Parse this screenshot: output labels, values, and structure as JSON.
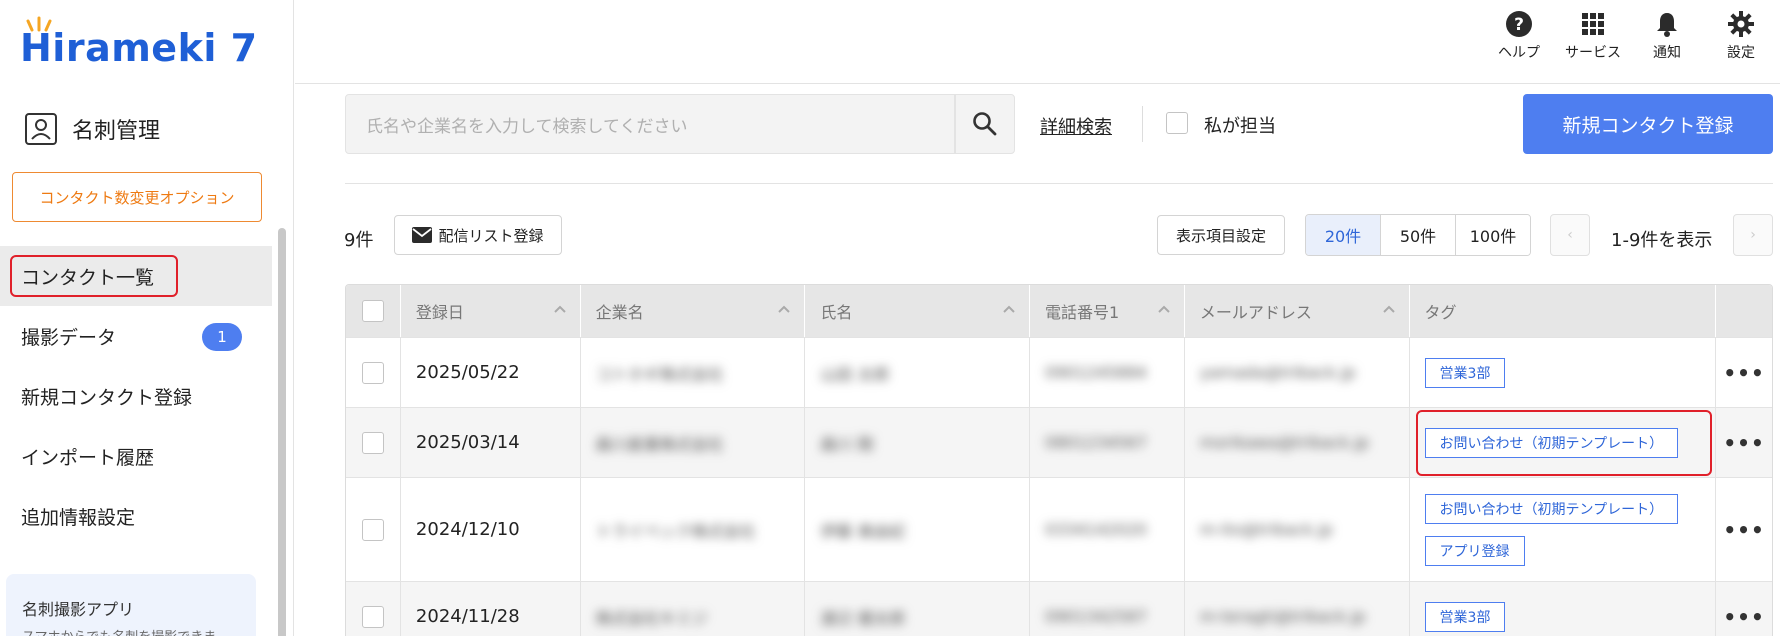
{
  "sidebar": {
    "logo": "Hirameki 7",
    "module_label": "名刺管理",
    "option_button": "コンタクト数変更オプション",
    "nav": [
      {
        "label": "コンタクト一覧",
        "active": true
      },
      {
        "label": "撮影データ",
        "badge": "1"
      },
      {
        "label": "新規コンタクト登録"
      },
      {
        "label": "インポート履歴"
      },
      {
        "label": "追加情報設定"
      }
    ],
    "app_box": {
      "title": "名刺撮影アプリ",
      "subtitle": "スマホからでも名刺を撮影できま"
    }
  },
  "header": {
    "icons": [
      {
        "label": "ヘルプ",
        "icon": "help-icon"
      },
      {
        "label": "サービス",
        "icon": "grid-icon"
      },
      {
        "label": "通知",
        "icon": "bell-icon"
      },
      {
        "label": "設定",
        "icon": "gear-icon"
      }
    ]
  },
  "search": {
    "placeholder": "氏名や企業名を入力して検索してください",
    "advanced_label": "詳細検索",
    "mine_label": "私が担当",
    "new_contact_button": "新規コンタクト登録"
  },
  "toolbar": {
    "count": "9件",
    "distribution_button": "配信リスト登録",
    "columns_button": "表示項目設定",
    "per_page": [
      {
        "label": "20件",
        "selected": true
      },
      {
        "label": "50件",
        "selected": false
      },
      {
        "label": "100件",
        "selected": false
      }
    ],
    "page_info": "1-9件を表示"
  },
  "table": {
    "columns": [
      "登録日",
      "企業名",
      "氏名",
      "電話番号1",
      "メールアドレス",
      "タグ"
    ],
    "rows": [
      {
        "date": "2025/05/22",
        "company": "コトホギ株式会社",
        "name": "山田 太郎",
        "phone": "0901245884",
        "email": "yamada@triback.jp",
        "tags": [
          "営業3部"
        ]
      },
      {
        "date": "2025/03/14",
        "company": "森川産業株式会社",
        "name": "森川 剛",
        "phone": "0801234567",
        "email": "morikawa@triback.jp",
        "tags": [
          "お問い合わせ（初期テンプレート）"
        ]
      },
      {
        "date": "2024/12/10",
        "company": "トライベック株式会社",
        "name": "伊藤 美由紀",
        "phone": "0334142020",
        "email": "m-ito@triback.jp",
        "tags": [
          "お問い合わせ（初期テンプレート）",
          "アプリ登録"
        ]
      },
      {
        "date": "2024/11/28",
        "company": "株式会社キミジ",
        "name": "渡辺 健太郎",
        "phone": "0901342587",
        "email": "m-teragti@triback.jp",
        "tags": [
          "営業3部"
        ]
      }
    ]
  },
  "colors": {
    "accent": "#4e7ef0",
    "orange": "#ee7a12",
    "highlight": "#e0202a"
  }
}
